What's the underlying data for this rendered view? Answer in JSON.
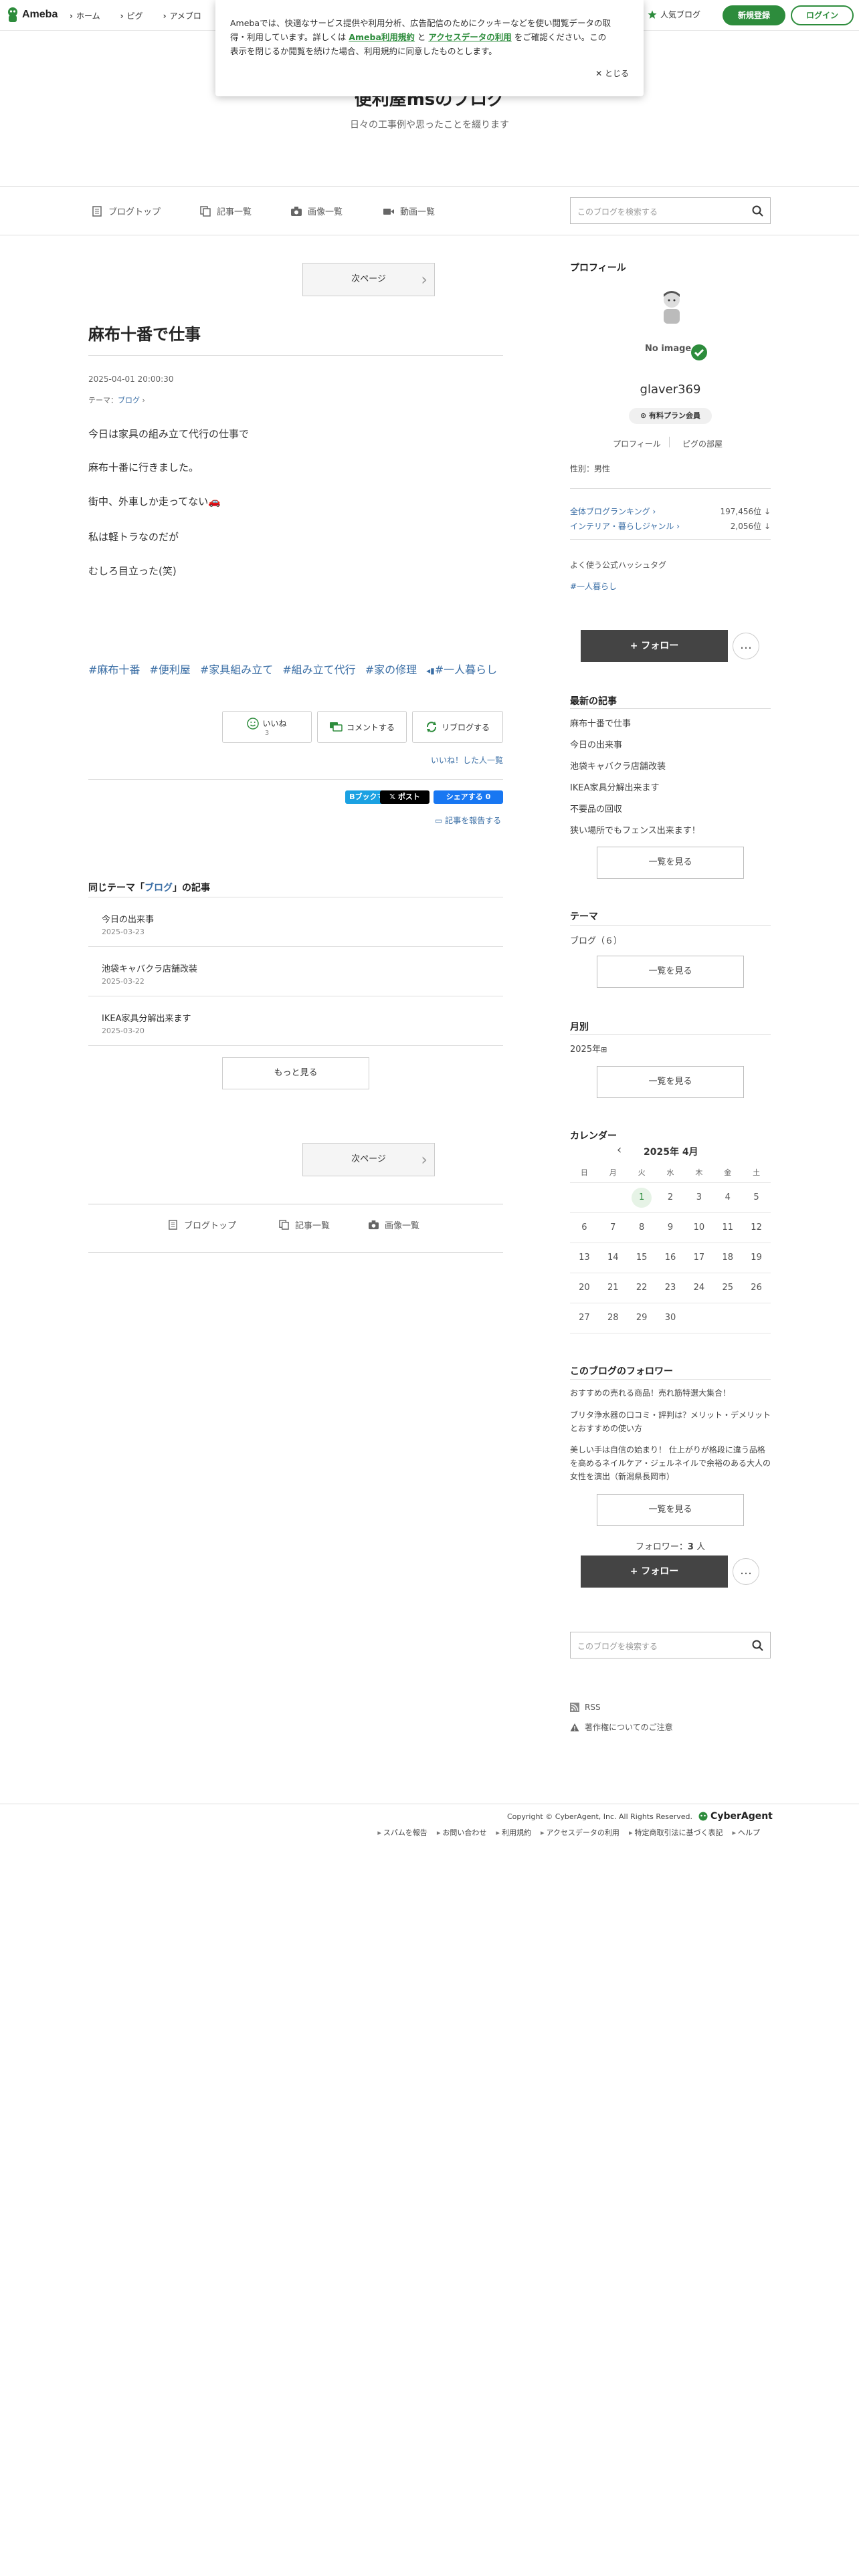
{
  "header": {
    "logo_text": "Ameba",
    "nav": [
      "ホーム",
      "ピグ",
      "アメブロ"
    ],
    "popular_label": "人気ブログ",
    "register_label": "新規登録",
    "login_label": "ログイン"
  },
  "cookie": {
    "text1": "Amebaでは、快適なサービス提供や利用分析、広告配信のためにクッキーなどを使い閲覧データの取",
    "text2a": "得・利用しています。詳しくは ",
    "link1": "Ameba利用規約",
    "text2b": " と ",
    "link2": "アクセスデータの利用",
    "text2c": " をご確認ください。この",
    "text3": "表示を閉じるか閲覧を続けた場合、利用規約に同意したものとします。",
    "close_label": "とじる"
  },
  "blog": {
    "title": "便利屋msのブログ",
    "description": "日々の工事例や思ったことを綴ります"
  },
  "blognav": {
    "top": "ブログトップ",
    "entries": "記事一覧",
    "images": "画像一覧",
    "videos": "動画一覧",
    "search_placeholder": "このブログを検索する"
  },
  "article": {
    "next_label": "次ページ",
    "title": "麻布十番で仕事",
    "datetime": "2025-04-01 20:00:30",
    "theme_prefix": "テーマ：",
    "theme": "ブログ",
    "paragraphs": [
      "今日は家具の組み立て代行の仕事で",
      "麻布十番に行きました。",
      "街中、外車しか走ってない🚗",
      "私は軽トラなのだが",
      "むしろ目立った(笑)"
    ],
    "tags": [
      "#麻布十番",
      "#便利屋",
      "#家具組み立て",
      "#組み立て代行",
      "#家の修理",
      "#一人暮らし"
    ],
    "like_label": "いいね",
    "like_count": "3",
    "comment_label": "コメントする",
    "reblog_label": "リブログする",
    "liked_users_link": "いいね！した人一覧",
    "bookmark_label": "Bブックマーク 0",
    "post_label": "𝕏 ポスト",
    "share_label": "シェアする 0",
    "report_label": "記事を報告する"
  },
  "related": {
    "heading_pre": "同じテーマ「",
    "heading_theme": "ブログ",
    "heading_post": "」の記事",
    "items": [
      {
        "title": "今日の出来事",
        "date": "2025-03-23"
      },
      {
        "title": "池袋キャバクラ店舗改装",
        "date": "2025-03-22"
      },
      {
        "title": "IKEA家具分解出来ます",
        "date": "2025-03-20"
      }
    ],
    "more_label": "もっと見る"
  },
  "bottomnav": {
    "next_label": "次ページ",
    "top": "ブログトップ",
    "entries": "記事一覧",
    "images": "画像一覧"
  },
  "sidebar": {
    "profile_heading": "プロフィール",
    "no_image": "No image",
    "username": "glaver369",
    "plan_badge": "有料プラン会員",
    "profile_link": "プロフィール",
    "pig_link": "ピグの部屋",
    "gender": "性別：男性",
    "rank_all_label": "全体ブログランキング",
    "rank_all_value": "197,456位",
    "rank_genre_label": "インテリア・暮らしジャンル",
    "rank_genre_value": "2,056位",
    "hashtag_heading": "よく使う公式ハッシュタグ",
    "hashtag": "#一人暮らし",
    "follow_label": "+ フォロー",
    "more_dots": "…",
    "latest_heading": "最新の記事",
    "latest": [
      "麻布十番で仕事",
      "今日の出来事",
      "池袋キャバクラ店舗改装",
      "IKEA家具分解出来ます",
      "不要品の回収",
      "狭い場所でもフェンス出来ます！"
    ],
    "list_label": "一覧を見る",
    "theme_heading": "テーマ",
    "theme_item": "ブログ（６）",
    "monthly_heading": "月別",
    "monthly_item": "2025年",
    "calendar_heading": "カレンダー",
    "calendar_month": "2025年 4月",
    "weekdays": [
      "日",
      "月",
      "火",
      "水",
      "木",
      "金",
      "土"
    ],
    "weeks": [
      [
        "",
        "",
        "1",
        "2",
        "3",
        "4",
        "5"
      ],
      [
        "6",
        "7",
        "8",
        "9",
        "10",
        "11",
        "12"
      ],
      [
        "13",
        "14",
        "15",
        "16",
        "17",
        "18",
        "19"
      ],
      [
        "20",
        "21",
        "22",
        "23",
        "24",
        "25",
        "26"
      ],
      [
        "27",
        "28",
        "29",
        "30",
        "",
        "",
        ""
      ]
    ],
    "followers_heading": "このブログのフォロワー",
    "followers_posts": [
      "おすすめの売れる商品！売れ筋特選大集合！",
      "ブリタ浄水器の口コミ・評判は？メリット・デメリットとおすすめの使い方",
      "美しい手は自信の始まり！ 仕上がりが格段に違う品格を高めるネイルケア・ジェルネイルで余裕のある大人の女性を演出（新潟県長岡市）"
    ],
    "follower_count_label": "フォロワー：",
    "follower_count": "3",
    "follower_count_unit": " 人",
    "search_placeholder": "このブログを検索する",
    "rss": "RSS",
    "copyright_notice": "著作権についてのご注意"
  },
  "footer": {
    "copyright": "Copyright © CyberAgent, Inc. All Rights Reserved.",
    "brand": "CyberAgent",
    "links": [
      "スパムを報告",
      "お問い合わせ",
      "利用規約",
      "アクセスデータの利用",
      "特定商取引法に基づく表記",
      "ヘルプ"
    ]
  },
  "colors": {
    "accent": "#2d8c3c",
    "link": "#3a6ea5",
    "follow_button": "#444444"
  }
}
